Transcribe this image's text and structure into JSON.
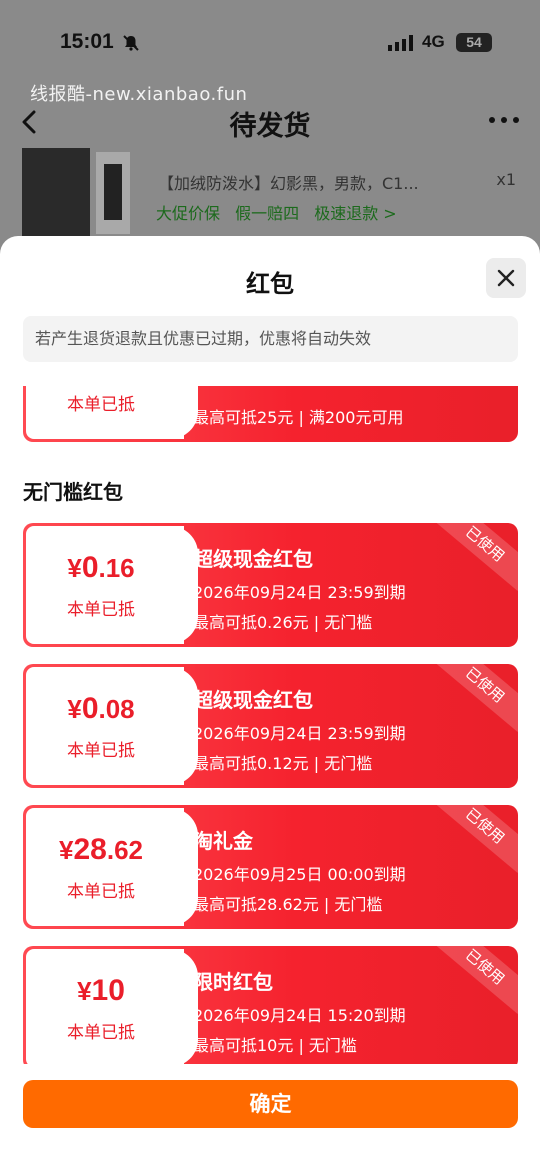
{
  "status_bar": {
    "time": "15:01",
    "network": "4G",
    "battery": "54"
  },
  "watermark": "线报酷-new.xianbao.fun",
  "nav": {
    "title": "待发货"
  },
  "product": {
    "description": "【加绒防泼水】幻影黑，男款，C1...",
    "quantity": "x1",
    "tags": [
      "大促价保",
      "假一赔四",
      "极速退款 >"
    ]
  },
  "sheet": {
    "title": "红包",
    "notice": "若产生退货退款且优惠已过期，优惠将自动失效",
    "section_label": "无门槛红包",
    "confirm_label": "确定"
  },
  "partial_coupon": {
    "sub_label": "本单已抵",
    "limit": "最高可抵25元 | 满200元可用"
  },
  "coupons": [
    {
      "yen": "¥",
      "int": "0",
      "dec": ".16",
      "sub_label": "本单已抵",
      "name": "超级现金红包",
      "expire": "2026年09月24日  23:59到期",
      "limit": "最高可抵0.26元 | 无门槛",
      "stamp": "已使用"
    },
    {
      "yen": "¥",
      "int": "0",
      "dec": ".08",
      "sub_label": "本单已抵",
      "name": "超级现金红包",
      "expire": "2026年09月24日  23:59到期",
      "limit": "最高可抵0.12元 | 无门槛",
      "stamp": "已使用"
    },
    {
      "yen": "¥",
      "int": "28",
      "dec": ".62",
      "sub_label": "本单已抵",
      "name": "淘礼金",
      "expire": "2026年09月25日  00:00到期",
      "limit": "最高可抵28.62元 | 无门槛",
      "stamp": "已使用"
    },
    {
      "yen": "¥",
      "int": "10",
      "dec": "",
      "sub_label": "本单已抵",
      "name": "限时红包",
      "expire": "2026年09月24日  15:20到期",
      "limit": "最高可抵10元 | 无门槛",
      "stamp": "已使用"
    }
  ],
  "colors": {
    "coupon_red": "#f5222e",
    "amount_red": "#ea1e2a",
    "confirm_orange": "#ff6a00"
  }
}
